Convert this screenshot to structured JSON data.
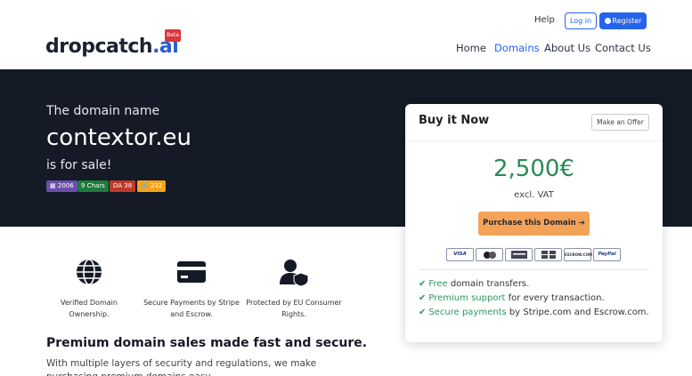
{
  "header": {
    "logo_text": "dropcatch",
    "logo_suffix": ".ai",
    "beta_label": "Beta",
    "help_label": "Help",
    "login_label": "Log in",
    "register_label": "Register",
    "nav": [
      "Home",
      "Domains",
      "About Us",
      "Contact Us"
    ],
    "active_nav": "Domains"
  },
  "hero": {
    "line1": "The domain name",
    "domain": "contextor.eu",
    "line2": "is for sale!",
    "badges": [
      {
        "text": "2006",
        "icon": "calendar-icon",
        "color": "#6b4fa8"
      },
      {
        "text": "9 Chars",
        "color": "#1e7a3e"
      },
      {
        "text": "DA 38",
        "color": "#c0392b"
      },
      {
        "text": "232",
        "icon": "link-icon",
        "color": "#f2a41d"
      }
    ]
  },
  "features": [
    {
      "icon": "globe-icon",
      "text": "Verified Domain Ownership."
    },
    {
      "icon": "credit-card-icon",
      "text": "Secure Payments by Stripe and Escrow."
    },
    {
      "icon": "user-shield-icon",
      "text": "Protected by EU Consumer Rights."
    }
  ],
  "section": {
    "title": "Premium domain sales made fast and secure.",
    "text": "With multiple layers of security and regulations, we make purchasing premium domains easy."
  },
  "card": {
    "title": "Buy it Now",
    "offer_label": "Make an Offer",
    "price": "2,500€",
    "vat": "excl. VAT",
    "purchase_label": "Purchase this Domain",
    "payment_methods": [
      "VISA",
      "mastercard",
      "amex",
      "bank",
      "ESCROW.COM",
      "PayPal"
    ],
    "bullets": [
      {
        "highlight": "Free",
        "rest": "domain transfers."
      },
      {
        "highlight": "Premium support",
        "rest": "for every transaction."
      },
      {
        "highlight": "Secure payments",
        "rest": "by Stripe.com and Escrow.com."
      }
    ]
  },
  "colors": {
    "hero_bg": "#141a26",
    "accent_blue": "#2563eb",
    "price_green": "#2a8a55",
    "purchase_orange": "#f4a259"
  }
}
